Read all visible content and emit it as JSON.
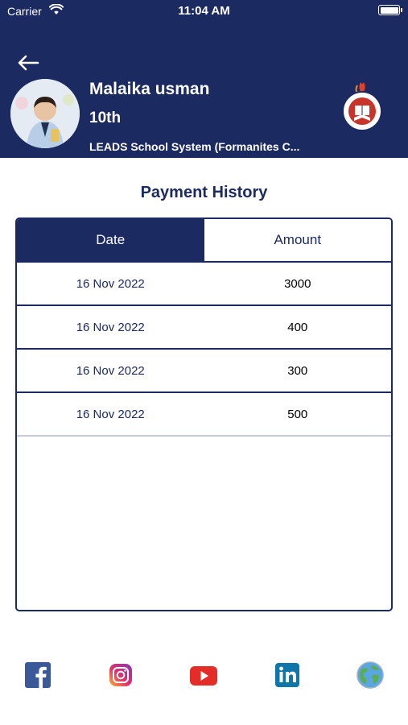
{
  "status_bar": {
    "carrier": "Carrier",
    "time": "11:04 AM"
  },
  "profile": {
    "name": "Malaika usman",
    "class": "10th",
    "school": "LEADS School System (Formanites C..."
  },
  "page": {
    "title": "Payment History"
  },
  "table": {
    "headers": {
      "date": "Date",
      "amount": "Amount"
    },
    "rows": [
      {
        "date": "16 Nov 2022",
        "amount": "3000"
      },
      {
        "date": "16 Nov 2022",
        "amount": "400"
      },
      {
        "date": "16 Nov 2022",
        "amount": "300"
      },
      {
        "date": "16 Nov 2022",
        "amount": "500"
      }
    ]
  },
  "social": [
    "facebook-icon",
    "instagram-icon",
    "youtube-icon",
    "linkedin-icon",
    "globe-icon"
  ],
  "colors": {
    "primary": "#1b2a61",
    "background": "#ffffff"
  }
}
